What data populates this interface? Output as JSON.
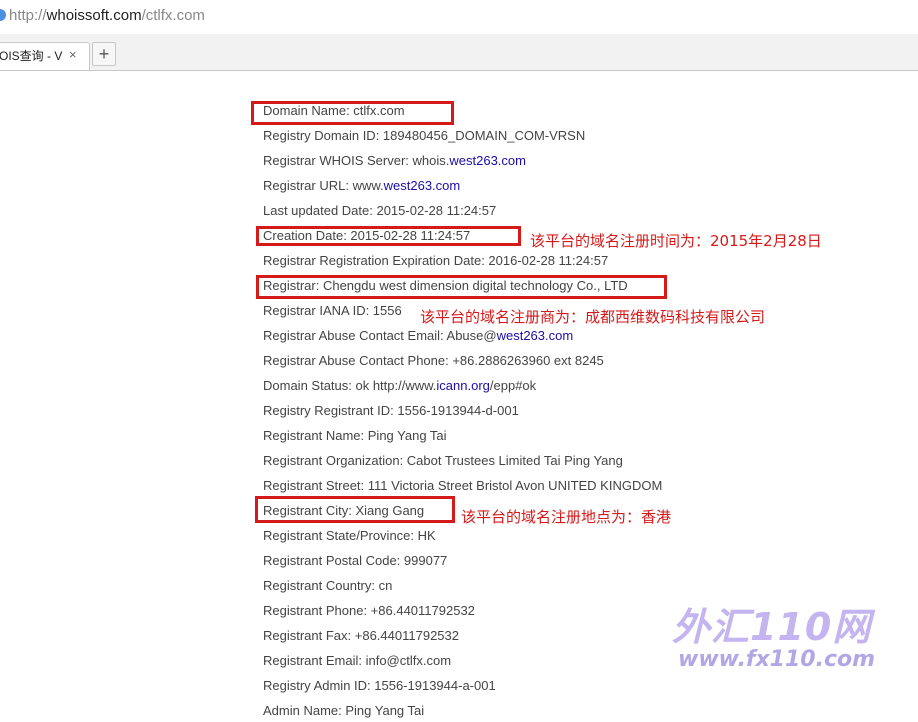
{
  "browser": {
    "url_scheme": "http://",
    "url_host": "whoissoft.com",
    "url_path": "/ctlfx.com",
    "tab_title": "OIS查询 - V",
    "tab_close": "×",
    "new_tab": "+"
  },
  "whois": [
    {
      "text": "Domain Name: ctlfx.com"
    },
    {
      "text": "Registry Domain ID: 189480456_DOMAIN_COM-VRSN"
    },
    {
      "text": "Registrar WHOIS Server: whois.",
      "link": "west263.com",
      "after": ""
    },
    {
      "text": "Registrar URL: www.",
      "link": "west263.com",
      "after": ""
    },
    {
      "text": "Last updated Date: 2015-02-28 11:24:57"
    },
    {
      "text": "Creation Date: 2015-02-28 11:24:57"
    },
    {
      "text": "Registrar Registration Expiration Date: 2016-02-28 11:24:57"
    },
    {
      "text": "Registrar: Chengdu west dimension digital technology Co., LTD"
    },
    {
      "text": "Registrar IANA ID: 1556"
    },
    {
      "text": "Registrar Abuse Contact Email: Abuse@",
      "link": "west263.com",
      "after": ""
    },
    {
      "text": "Registrar Abuse Contact Phone: +86.2886263960 ext 8245"
    },
    {
      "text": "Domain Status: ok http://www.",
      "link": "icann.org",
      "after": "/epp#ok"
    },
    {
      "text": "Registry Registrant ID: 1556-1913944-d-001"
    },
    {
      "text": "Registrant Name: Ping Yang Tai"
    },
    {
      "text": "Registrant Organization: Cabot Trustees Limited Tai Ping Yang"
    },
    {
      "text": "Registrant Street: 111 Victoria Street Bristol Avon UNITED KINGDOM"
    },
    {
      "text": "Registrant City: Xiang Gang"
    },
    {
      "text": "Registrant State/Province: HK"
    },
    {
      "text": "Registrant Postal Code: 999077"
    },
    {
      "text": "Registrant Country: cn"
    },
    {
      "text": "Registrant Phone: +86.44011792532"
    },
    {
      "text": "Registrant Fax: +86.44011792532"
    },
    {
      "text": "Registrant Email: info@ctlfx.com"
    },
    {
      "text": "Registry Admin ID: 1556-1913944-a-001"
    },
    {
      "text": "Admin Name: Ping Yang Tai"
    }
  ],
  "annotations": [
    "该平台的域名注册时间为：2015年2月28日",
    "该平台的域名注册商为：成都西维数码科技有限公司",
    "该平台的域名注册地点为：香港"
  ],
  "watermark": {
    "brand": "外汇110网",
    "url": "www.fx110.com"
  },
  "colors": {
    "highlight": "#d61a1a",
    "link": "#1a0dab",
    "text": "#444444"
  }
}
